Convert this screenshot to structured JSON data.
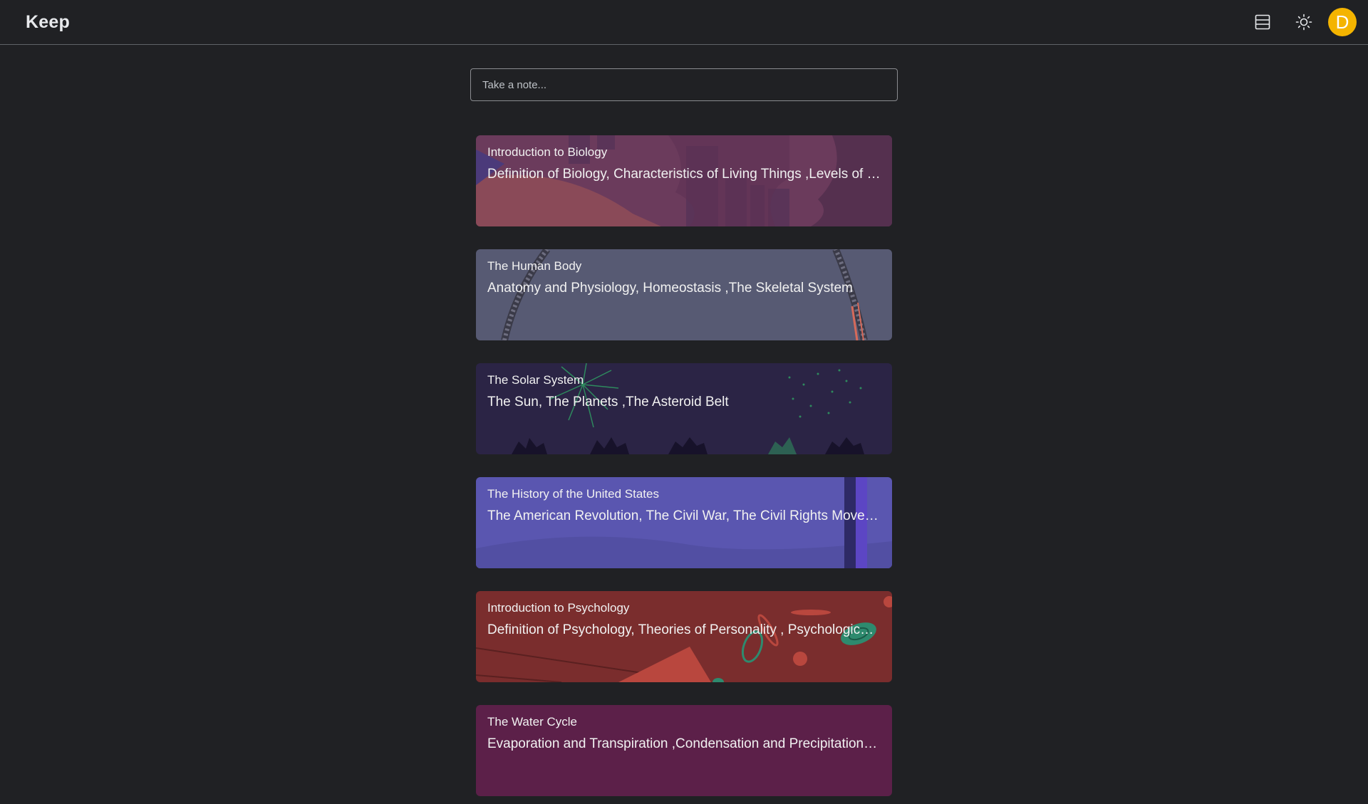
{
  "app": {
    "title": "Keep"
  },
  "header": {
    "view_toggle_icon": "list-view-icon",
    "theme_icon": "sun-icon",
    "avatar_letter": "D",
    "avatar_color": "#f4b400"
  },
  "composer": {
    "placeholder": "Take a note..."
  },
  "notes": [
    {
      "title": "Introduction to Biology",
      "body": "Definition of Biology, Characteristics of Living Things ,Levels of Biological Organization",
      "color": "#7b3f5e"
    },
    {
      "title": "The Human Body",
      "body": "Anatomy and Physiology, Homeostasis ,The Skeletal System",
      "color": "#5c5f7a"
    },
    {
      "title": "The Solar System",
      "body": "The Sun, The Planets ,The Asteroid Belt",
      "color": "#2a2347"
    },
    {
      "title": "The History of the United States",
      "body": "The American Revolution, The Civil War, The Civil Rights Movement",
      "color": "#5a57b5"
    },
    {
      "title": "Introduction to Psychology",
      "body": "Definition of Psychology, Theories of Personality , Psychological Disorders",
      "color": "#7c2b2b"
    },
    {
      "title": "The Water Cycle",
      "body": "Evaporation and Transpiration ,Condensation and Precipitation , Collection",
      "color": "#5c1f48"
    }
  ]
}
